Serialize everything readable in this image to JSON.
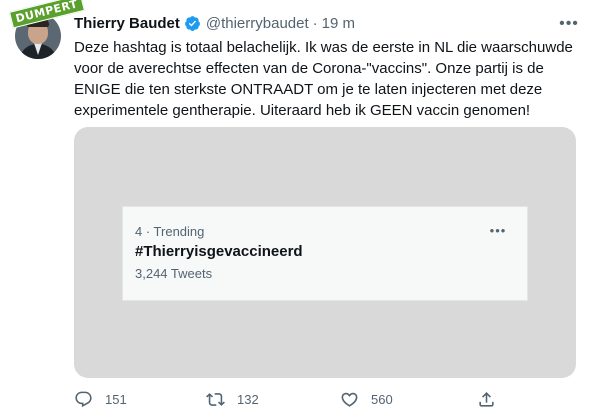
{
  "watermark": {
    "text": "DUMPERT",
    "color": "#5aa02c"
  },
  "author": {
    "name": "Thierry Baudet",
    "verified_icon": "verified-badge-icon",
    "handle": "@thierrybaudet",
    "separator": "·",
    "time": "19 m"
  },
  "tweet": {
    "lines": [
      "Deze hashtag is totaal belachelijk. Ik was de eerste in NL die waarschuwde",
      "voor de averechtse effecten van de Corona-\"vaccins\". Onze partij is de",
      "ENIGE die ten sterkste ONTRAADT om je te laten injecteren met deze",
      "experimentele gentherapie. Uiteraard heb ik GEEN vaccin genomen!"
    ]
  },
  "trend": {
    "meta": "4 · Trending",
    "hashtag": "#Thierryisgevaccineerd",
    "count": "3,244 Tweets"
  },
  "actions": {
    "replies": "151",
    "retweets": "132",
    "likes": "560"
  },
  "colors": {
    "accent": "#1d9bf0",
    "muted": "#536471",
    "text": "#0f1419",
    "media_bg": "#d9d9d9"
  }
}
